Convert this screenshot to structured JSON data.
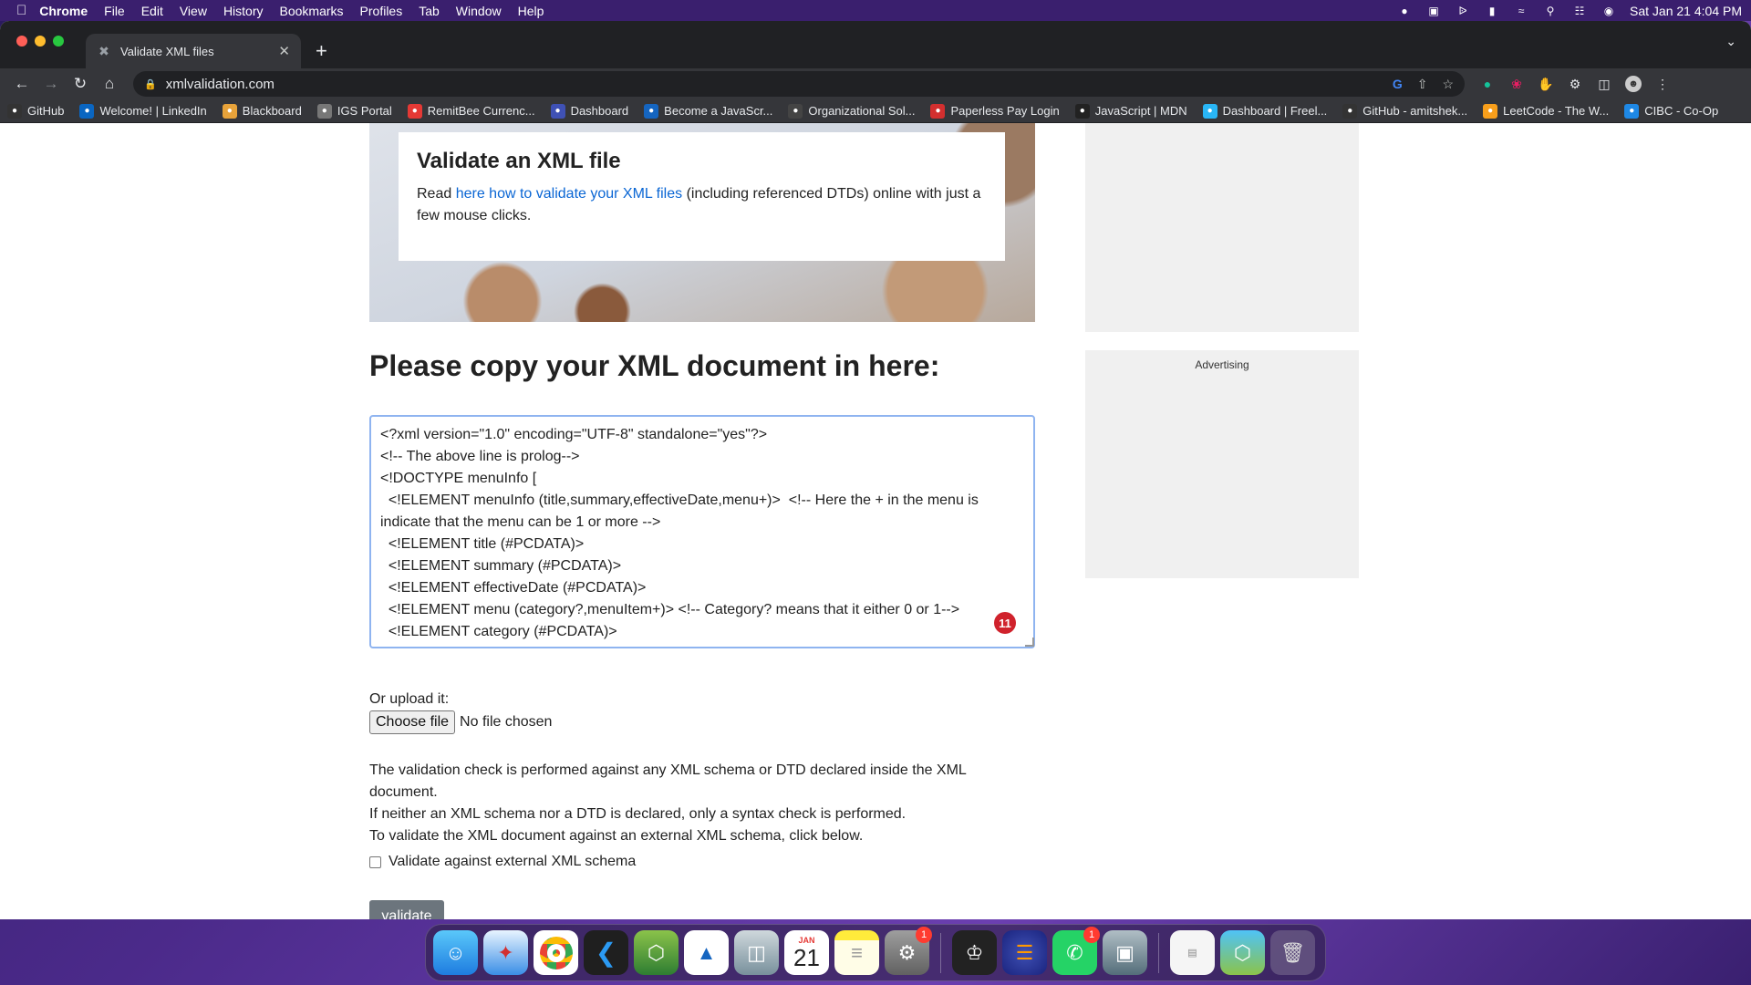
{
  "menubar": {
    "app": "Chrome",
    "items": [
      "File",
      "Edit",
      "View",
      "History",
      "Bookmarks",
      "Profiles",
      "Tab",
      "Window",
      "Help"
    ],
    "clock": "Sat Jan 21  4:04 PM"
  },
  "tab": {
    "title": "Validate XML files"
  },
  "omnibox": {
    "url": "xmlvalidation.com"
  },
  "bookmarks": [
    {
      "label": "GitHub",
      "icon": "github-icon",
      "color": "#333333"
    },
    {
      "label": "Welcome! | LinkedIn",
      "icon": "linkedin-icon",
      "color": "#0a66c2"
    },
    {
      "label": "Blackboard",
      "icon": "blackboard-icon",
      "color": "#e8a33a"
    },
    {
      "label": "IGS Portal",
      "icon": "igs-icon",
      "color": "#777777"
    },
    {
      "label": "RemitBee Currenc...",
      "icon": "remitbee-icon",
      "color": "#e53935"
    },
    {
      "label": "Dashboard",
      "icon": "dashboard-icon",
      "color": "#3f51b5"
    },
    {
      "label": "Become a JavaScr...",
      "icon": "udemy-icon",
      "color": "#1565c0"
    },
    {
      "label": "Organizational Sol...",
      "icon": "org-icon",
      "color": "#444444"
    },
    {
      "label": "Paperless Pay Login",
      "icon": "paperless-icon",
      "color": "#d32f2f"
    },
    {
      "label": "JavaScript | MDN",
      "icon": "mdn-icon",
      "color": "#222222"
    },
    {
      "label": "Dashboard | Freel...",
      "icon": "freelancer-icon",
      "color": "#29b6f6"
    },
    {
      "label": "GitHub - amitshek...",
      "icon": "github-icon",
      "color": "#333333"
    },
    {
      "label": "LeetCode - The W...",
      "icon": "leetcode-icon",
      "color": "#f89f1b"
    },
    {
      "label": "CIBC - Co-Op",
      "icon": "cibc-icon",
      "color": "#1e88e5"
    }
  ],
  "hero": {
    "title": "Validate an XML file",
    "text_before": "Read ",
    "link": "here how to validate your XML files",
    "text_after": " (including referenced DTDs) online with just a few mouse clicks."
  },
  "ad": {
    "label": "Advertising"
  },
  "main": {
    "title": "Please copy your XML document in here:",
    "xml_content": "<?xml version=\"1.0\" encoding=\"UTF-8\" standalone=\"yes\"?>\n<!-- The above line is prolog-->\n<!DOCTYPE menuInfo [\n  <!ELEMENT menuInfo (title,summary,effectiveDate,menu+)>  <!-- Here the + in the menu is indicate that the menu can be 1 or more -->\n  <!ELEMENT title (#PCDATA)>\n  <!ELEMENT summary (#PCDATA)>\n  <!ELEMENT effectiveDate (#PCDATA)>\n  <!ELEMENT menu (category?,menuItem+)> <!-- Category? means that it either 0 or 1-->\n  <!ELEMENT category (#PCDATA)>",
    "grammar_badge": "11",
    "upload_label": "Or upload it:",
    "choose_file": "Choose file",
    "no_file": "No file chosen",
    "info_1": "The validation check is performed against any XML schema or DTD declared inside the XML document.",
    "info_2": "If neither an XML schema nor a DTD is declared, only a syntax check is performed.",
    "info_3": "To validate the XML document against an external XML schema, click below.",
    "checkbox_label": "Validate against external XML schema",
    "checkbox_checked": false,
    "validate_button": "validate"
  },
  "dock": {
    "calendar_month": "JAN",
    "calendar_day": "21",
    "settings_badge": "1",
    "whatsapp_badge": "1"
  }
}
